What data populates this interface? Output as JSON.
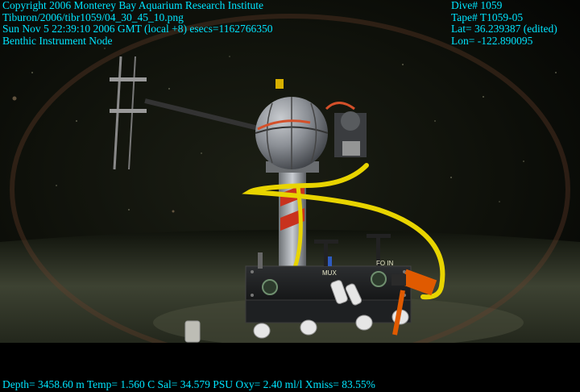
{
  "overlay": {
    "left": [
      "Copyright 2006 Monterey Bay Aquarium Research Institute",
      "Tiburon/2006/tibr1059/04_30_45_10.png",
      "Sun Nov  5 22:39:10 2006 GMT (local +8)  esecs=1162766350",
      "Benthic Instrument Node"
    ],
    "right": [
      "Dive# 1059",
      "Tape# T1059-05",
      "Lat= 36.239387 (edited)",
      "Lon= -122.890095"
    ],
    "bottom": "Depth= 3458.60 m  Temp= 1.560 C  Sal= 34.579 PSU  Oxy= 2.40 ml/l  Xmiss= 83.55%"
  },
  "instrument_labels": {
    "connector_fo": "FO IN",
    "connector_mu": "MUX"
  },
  "colors": {
    "overlay_text": "#00e5ff",
    "cable": "#e8d400",
    "sphere": "#8c9096",
    "stripe_red": "#c8321e",
    "hose_orange": "#e05a00"
  }
}
